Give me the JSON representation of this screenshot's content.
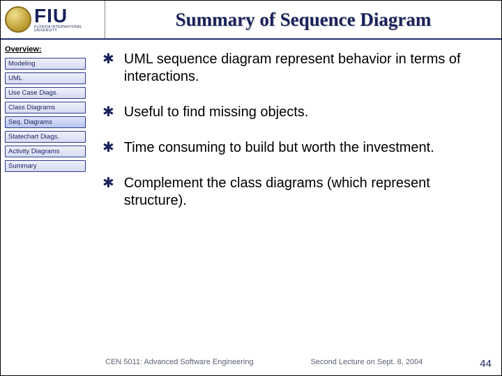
{
  "header": {
    "logo_main": "FIU",
    "logo_sub": "FLORIDA INTERNATIONAL UNIVERSITY",
    "title": "Summary of Sequence Diagram"
  },
  "sidebar": {
    "heading": "Overview:",
    "items": [
      {
        "label": "Modeling",
        "active": false
      },
      {
        "label": "UML",
        "active": false
      },
      {
        "label": "Use Case Diags.",
        "active": false
      },
      {
        "label": "Class Diagrams",
        "active": false
      },
      {
        "label": "Seq. Diagrams",
        "active": true
      },
      {
        "label": "Statechart Diags.",
        "active": false
      },
      {
        "label": "Activity Diagrams",
        "active": false
      },
      {
        "label": "Summary",
        "active": false
      }
    ]
  },
  "bullets": [
    "UML sequence diagram represent behavior in terms of interactions.",
    "Useful to find missing objects.",
    "Time consuming to build but worth the investment.",
    "Complement the class diagrams (which represent structure)."
  ],
  "footer": {
    "left": "CEN 5011: Advanced Software Engineering",
    "right": "Second Lecture on Sept. 8, 2004",
    "page": "44"
  }
}
